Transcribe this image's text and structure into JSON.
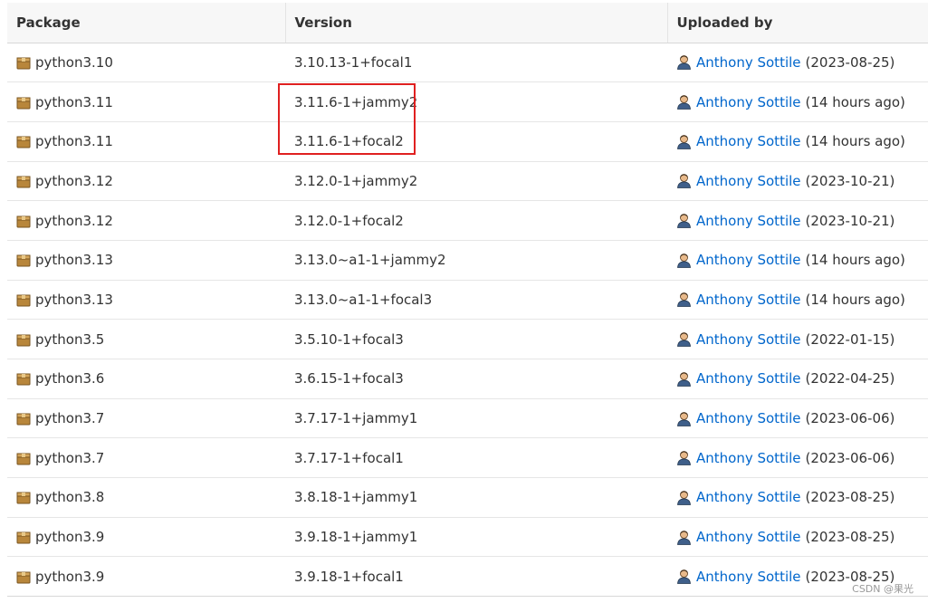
{
  "table": {
    "headers": {
      "package": "Package",
      "version": "Version",
      "uploaded_by": "Uploaded by"
    },
    "rows": [
      {
        "package": "python3.10",
        "version": "3.10.13-1+focal1",
        "uploader": "Anthony Sottile",
        "when": "(2023-08-25)"
      },
      {
        "package": "python3.11",
        "version": "3.11.6-1+jammy2",
        "uploader": "Anthony Sottile",
        "when": "(14 hours ago)"
      },
      {
        "package": "python3.11",
        "version": "3.11.6-1+focal2",
        "uploader": "Anthony Sottile",
        "when": "(14 hours ago)"
      },
      {
        "package": "python3.12",
        "version": "3.12.0-1+jammy2",
        "uploader": "Anthony Sottile",
        "when": "(2023-10-21)"
      },
      {
        "package": "python3.12",
        "version": "3.12.0-1+focal2",
        "uploader": "Anthony Sottile",
        "when": "(2023-10-21)"
      },
      {
        "package": "python3.13",
        "version": "3.13.0~a1-1+jammy2",
        "uploader": "Anthony Sottile",
        "when": "(14 hours ago)"
      },
      {
        "package": "python3.13",
        "version": "3.13.0~a1-1+focal3",
        "uploader": "Anthony Sottile",
        "when": "(14 hours ago)"
      },
      {
        "package": "python3.5",
        "version": "3.5.10-1+focal3",
        "uploader": "Anthony Sottile",
        "when": "(2022-01-15)"
      },
      {
        "package": "python3.6",
        "version": "3.6.15-1+focal3",
        "uploader": "Anthony Sottile",
        "when": "(2022-04-25)"
      },
      {
        "package": "python3.7",
        "version": "3.7.17-1+jammy1",
        "uploader": "Anthony Sottile",
        "when": "(2023-06-06)"
      },
      {
        "package": "python3.7",
        "version": "3.7.17-1+focal1",
        "uploader": "Anthony Sottile",
        "when": "(2023-06-06)"
      },
      {
        "package": "python3.8",
        "version": "3.8.18-1+jammy1",
        "uploader": "Anthony Sottile",
        "when": "(2023-08-25)"
      },
      {
        "package": "python3.9",
        "version": "3.9.18-1+jammy1",
        "uploader": "Anthony Sottile",
        "when": "(2023-08-25)"
      },
      {
        "package": "python3.9",
        "version": "3.9.18-1+focal1",
        "uploader": "Anthony Sottile",
        "when": "(2023-08-25)"
      }
    ]
  },
  "icons": {
    "package": "package-icon",
    "uploader": "person-icon"
  },
  "colors": {
    "link": "#0066cc",
    "highlight": "#e02020",
    "package_icon": "#b8863b"
  },
  "watermark": "CSDN @果光"
}
